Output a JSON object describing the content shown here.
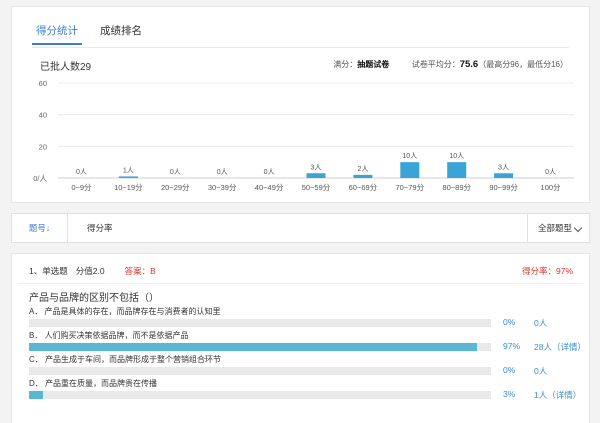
{
  "tabs": [
    {
      "label": "得分统计",
      "active": true
    },
    {
      "label": "成绩排名",
      "active": false
    }
  ],
  "summary": {
    "graded_label": "已批人数29",
    "full_score_label": "满分：",
    "full_score_value": "抽题试卷",
    "avg_label": "试卷平均分：",
    "avg_value": "75.6",
    "range_text": "（最高分96，最低分16）"
  },
  "chart_data": {
    "type": "bar",
    "categories": [
      "0~9分",
      "10~19分",
      "20~29分",
      "30~39分",
      "40~49分",
      "50~59分",
      "60~69分",
      "70~79分",
      "80~89分",
      "90~99分",
      "100分"
    ],
    "values": [
      0,
      1,
      0,
      0,
      0,
      3,
      2,
      10,
      10,
      3,
      0
    ],
    "data_labels": [
      "0人",
      "1人",
      "0人",
      "0人",
      "0人",
      "3人",
      "2人",
      "10人",
      "10人",
      "3人",
      "0人"
    ],
    "y_ticks": [
      "0/人",
      "20",
      "40",
      "60"
    ],
    "ylim": [
      0,
      60
    ],
    "grid": true,
    "bar_color": "#3aa3d8",
    "title": "",
    "xlabel": "",
    "ylabel": ""
  },
  "filter": {
    "question_no_label": "题号↓",
    "rate_label": "得分率",
    "type_label": "全部题型"
  },
  "question": {
    "header": "1、单选题",
    "score": "分值2.0",
    "answer": "答案：B",
    "rate": "得分率：97%",
    "text": "产品与品牌的区别不包括（）",
    "options": [
      {
        "label": "A． 产品是具体的存在，而品牌存在与消费者的认知里",
        "fraction": 0.0,
        "percent": "0%",
        "count": "0人",
        "detail": ""
      },
      {
        "label": "B． 人们购买决策依据品牌，而不是依据产品",
        "fraction": 0.97,
        "percent": "97%",
        "count": "28人",
        "detail": "（详情）"
      },
      {
        "label": "C． 产品生成于车间，而品牌形成于整个营销组合环节",
        "fraction": 0.0,
        "percent": "0%",
        "count": "0人",
        "detail": ""
      },
      {
        "label": "D． 产品重在质量，而品牌贵在传播",
        "fraction": 0.03,
        "percent": "3%",
        "count": "1人",
        "detail": "（详情）"
      }
    ],
    "bar_color": "#5ab7d4"
  }
}
